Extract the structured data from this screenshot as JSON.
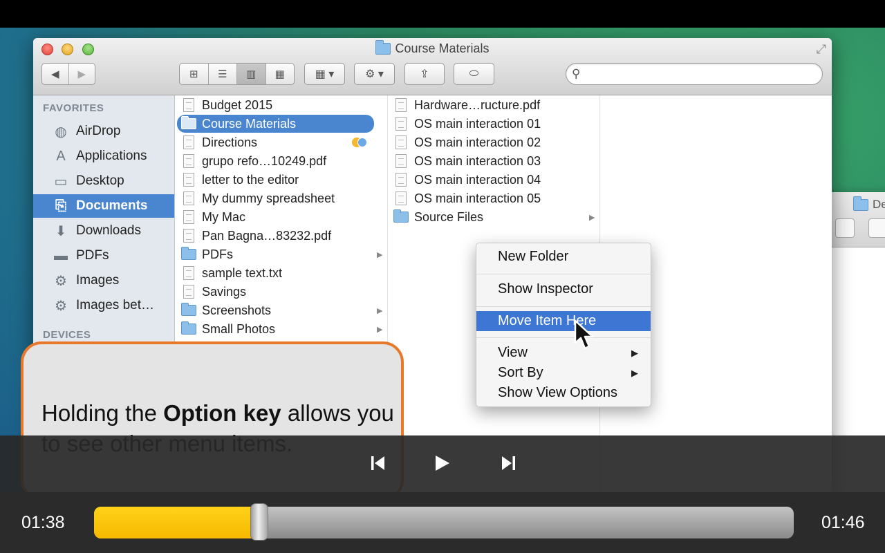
{
  "window": {
    "title": "Course Materials"
  },
  "background_window": {
    "title": "De"
  },
  "toolbar": {
    "back_icon": "back-arrow-icon",
    "forward_icon": "forward-arrow-icon",
    "view_modes": [
      "icon-view-icon",
      "list-view-icon",
      "column-view-icon",
      "coverflow-view-icon"
    ],
    "active_view": "column-view-icon",
    "search_placeholder": ""
  },
  "sidebar": {
    "favorites_label": "FAVORITES",
    "devices_label": "DEVICES",
    "items": [
      {
        "label": "AirDrop",
        "icon": "airdrop-icon",
        "glyph": "◍"
      },
      {
        "label": "Applications",
        "icon": "applications-icon",
        "glyph": "A"
      },
      {
        "label": "Desktop",
        "icon": "desktop-icon",
        "glyph": "▭"
      },
      {
        "label": "Documents",
        "icon": "documents-icon",
        "glyph": "⎘",
        "selected": true
      },
      {
        "label": "Downloads",
        "icon": "downloads-icon",
        "glyph": "⬇"
      },
      {
        "label": "PDFs",
        "icon": "folder-icon",
        "glyph": "▬"
      },
      {
        "label": "Images",
        "icon": "gear-icon",
        "glyph": "⚙"
      },
      {
        "label": "Images bet…",
        "icon": "gear-icon",
        "glyph": "⚙"
      }
    ]
  },
  "column1": {
    "items": [
      {
        "label": "Budget 2015",
        "kind": "doc"
      },
      {
        "label": "Course Materials",
        "kind": "folder",
        "selected": true,
        "has_children": true
      },
      {
        "label": "Directions",
        "kind": "doc",
        "tags": true
      },
      {
        "label": "grupo refo…10249.pdf",
        "kind": "doc"
      },
      {
        "label": "letter to the editor",
        "kind": "doc"
      },
      {
        "label": "My dummy spreadsheet",
        "kind": "doc"
      },
      {
        "label": "My Mac",
        "kind": "doc"
      },
      {
        "label": "Pan Bagna…83232.pdf",
        "kind": "doc"
      },
      {
        "label": "PDFs",
        "kind": "folder",
        "has_children": true
      },
      {
        "label": "sample text.txt",
        "kind": "doc"
      },
      {
        "label": "Savings",
        "kind": "doc"
      },
      {
        "label": "Screenshots",
        "kind": "folder",
        "has_children": true
      },
      {
        "label": "Small Photos",
        "kind": "folder",
        "has_children": true
      }
    ]
  },
  "column2": {
    "items": [
      {
        "label": "Hardware…ructure.pdf",
        "kind": "doc"
      },
      {
        "label": "OS main interaction 01",
        "kind": "doc"
      },
      {
        "label": "OS main interaction 02",
        "kind": "doc"
      },
      {
        "label": "OS main interaction 03",
        "kind": "doc"
      },
      {
        "label": "OS main interaction 04",
        "kind": "doc"
      },
      {
        "label": "OS main interaction 05",
        "kind": "doc"
      },
      {
        "label": "Source Files",
        "kind": "folder",
        "has_children": true
      }
    ]
  },
  "context_menu": {
    "items": [
      {
        "label": "New Folder"
      },
      {
        "label": "Show Inspector"
      },
      {
        "label": "Move Item Here",
        "highlighted": true
      },
      {
        "label": "View",
        "submenu": true
      },
      {
        "label": "Sort By",
        "submenu": true
      },
      {
        "label": "Show View Options"
      }
    ]
  },
  "callout": {
    "text_before": "Holding the ",
    "text_bold": "Option key",
    "text_after": " allows you to see other menu items."
  },
  "player": {
    "elapsed": "01:38",
    "remaining": "01:46",
    "progress": 0.236,
    "accent_color": "#f7b800"
  }
}
